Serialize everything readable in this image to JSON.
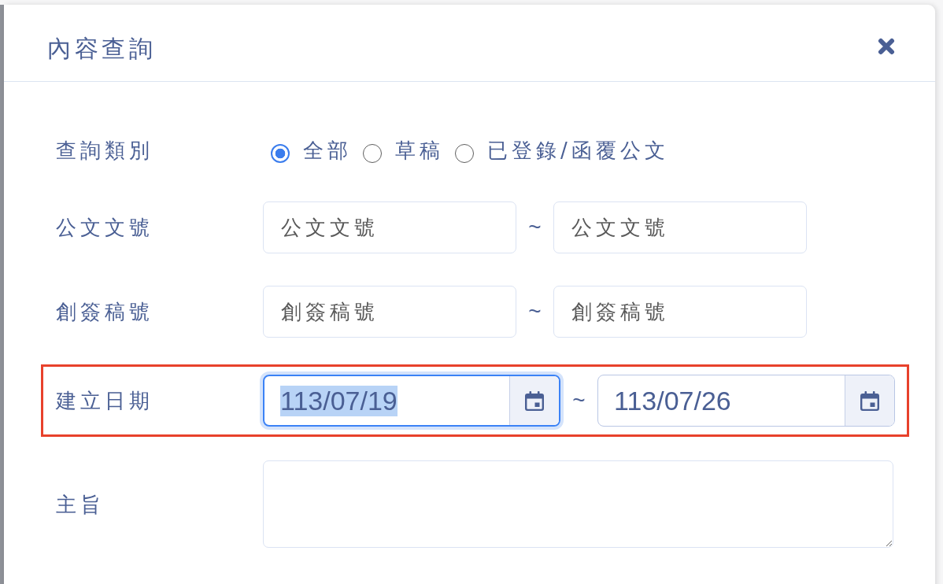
{
  "dialog": {
    "title": "內容查詢"
  },
  "form": {
    "rows": [
      {
        "kind": "radio",
        "label": "查詢類別",
        "highlighted": false,
        "options": [
          {
            "label": "全部",
            "selected": true
          },
          {
            "label": "草稿",
            "selected": false
          },
          {
            "label": "已登錄/函覆公文",
            "selected": false
          }
        ]
      },
      {
        "kind": "range",
        "label": "公文文號",
        "highlighted": false,
        "separator": "~",
        "fields": [
          {
            "placeholder": "公文文號"
          },
          {
            "placeholder": "公文文號"
          }
        ]
      },
      {
        "kind": "range",
        "label": "創簽稿號",
        "highlighted": false,
        "separator": "~",
        "fields": [
          {
            "placeholder": "創簽稿號"
          },
          {
            "placeholder": "創簽稿號"
          }
        ]
      },
      {
        "kind": "date_range",
        "label": "建立日期",
        "highlighted": true,
        "separator": "~",
        "fields": [
          {
            "value": "113/07/19",
            "focused": true,
            "value_selected": true
          },
          {
            "value": "113/07/26",
            "focused": false,
            "value_selected": false
          }
        ]
      },
      {
        "kind": "textarea",
        "label": "主旨",
        "highlighted": false
      }
    ]
  }
}
